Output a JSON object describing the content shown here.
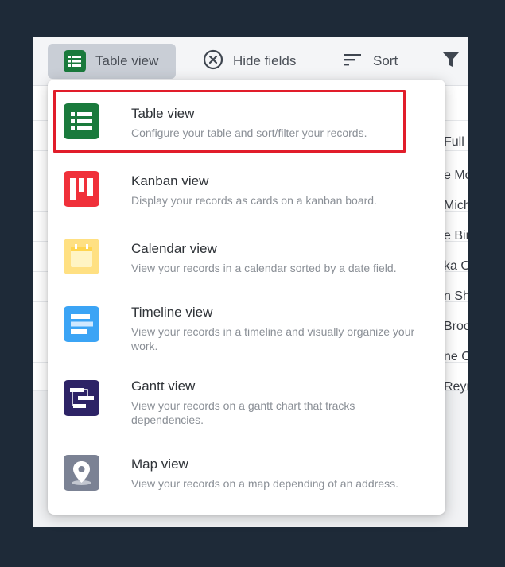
{
  "toolbar": {
    "table_view_label": "Table view",
    "hide_fields_label": "Hide fields",
    "sort_label": "Sort"
  },
  "background_rows": [
    "Full",
    "e Mo",
    "Mich",
    "e Bir",
    "ka O",
    "n Sh",
    "Broo",
    "ne O",
    "Reyn"
  ],
  "menu": {
    "items": [
      {
        "title": "Table view",
        "desc": "Configure your table and sort/filter your records.",
        "icon": "table-icon",
        "color": "#1a7a3c"
      },
      {
        "title": "Kanban view",
        "desc": "Display your records as cards on a kanban board.",
        "icon": "kanban-icon",
        "color": "#f0303a"
      },
      {
        "title": "Calendar view",
        "desc": "View your records in a calendar sorted by a date field.",
        "icon": "calendar-icon",
        "color": "#ffe082"
      },
      {
        "title": "Timeline view",
        "desc": "View your records in a timeline and visually organize your work.",
        "icon": "timeline-icon",
        "color": "#3ba4f5"
      },
      {
        "title": "Gantt view",
        "desc": "View your records on a gantt chart that tracks dependencies.",
        "icon": "gantt-icon",
        "color": "#2d2366"
      },
      {
        "title": "Map view",
        "desc": "View your records on a map depending of an address.",
        "icon": "map-pin-icon",
        "color": "#7b8294"
      }
    ]
  },
  "colors": {
    "backdrop": "#1e2a38",
    "highlight": "#e11d2a",
    "toolbar_active": "#c9ced6"
  }
}
